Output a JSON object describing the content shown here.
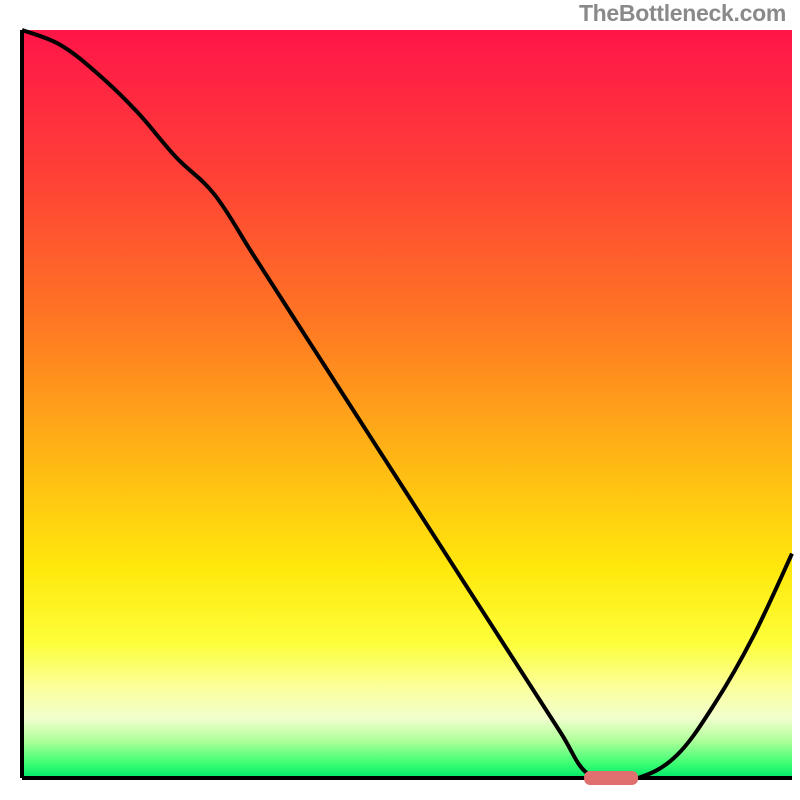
{
  "watermark": "TheBottleneck.com",
  "chart_data": {
    "type": "line",
    "title": "",
    "xlabel": "",
    "ylabel": "",
    "xlim": [
      0,
      100
    ],
    "ylim": [
      0,
      100
    ],
    "x": [
      0,
      5,
      10,
      15,
      20,
      25,
      30,
      35,
      40,
      45,
      50,
      55,
      60,
      65,
      70,
      73,
      76,
      80,
      85,
      90,
      95,
      100
    ],
    "values": [
      100,
      98,
      94,
      89,
      83,
      78,
      70,
      62,
      54,
      46,
      38,
      30,
      22,
      14,
      6,
      1,
      0,
      0,
      3,
      10,
      19,
      30
    ],
    "marker": {
      "x_start": 73,
      "x_end": 80,
      "y": 0
    },
    "gradient_stops": [
      {
        "pct": 0,
        "color": "#ff1549"
      },
      {
        "pct": 20,
        "color": "#ff4236"
      },
      {
        "pct": 40,
        "color": "#ff7a22"
      },
      {
        "pct": 58,
        "color": "#ffb914"
      },
      {
        "pct": 72,
        "color": "#ffe80c"
      },
      {
        "pct": 82,
        "color": "#fdff3a"
      },
      {
        "pct": 88,
        "color": "#fbff9e"
      },
      {
        "pct": 92,
        "color": "#f1ffcd"
      },
      {
        "pct": 95,
        "color": "#afff9a"
      },
      {
        "pct": 98,
        "color": "#3fff73"
      },
      {
        "pct": 100,
        "color": "#00e86b"
      }
    ],
    "axis_color": "#000000",
    "line_color": "#000000",
    "marker_color": "#e07070"
  }
}
